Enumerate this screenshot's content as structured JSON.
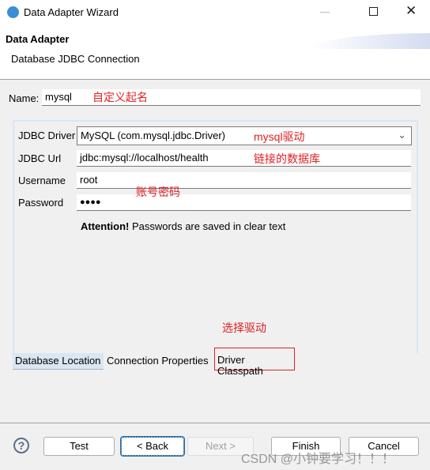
{
  "window": {
    "title": "Data Adapter Wizard"
  },
  "header": {
    "title": "Data Adapter",
    "subtitle": "Database JDBC Connection"
  },
  "name": {
    "label": "Name:",
    "value": "mysql"
  },
  "form": {
    "driver": {
      "label": "JDBC Driver",
      "value": "MySQL (com.mysql.jdbc.Driver)"
    },
    "url": {
      "label": "JDBC Url",
      "value": "jdbc:mysql://localhost/health"
    },
    "username": {
      "label": "Username",
      "value": "root"
    },
    "password": {
      "label": "Password",
      "value": "●●●●"
    },
    "attention_bold": "Attention!",
    "attention_text": "Passwords are saved in clear text"
  },
  "tabs": [
    {
      "label": "Database Location",
      "selected": true
    },
    {
      "label": "Connection Properties"
    },
    {
      "label": "Driver Classpath"
    }
  ],
  "buttons": {
    "test": "Test",
    "back": "< Back",
    "next": "Next >",
    "finish": "Finish",
    "cancel": "Cancel"
  },
  "annotations": {
    "name": "自定义起名",
    "driver": "mysql驱动",
    "url": "链接的数据库",
    "credentials": "账号密码",
    "classpath": "选择驱动",
    "color": "#e02020"
  },
  "watermark": "CSDN @小钟要学习！！！"
}
